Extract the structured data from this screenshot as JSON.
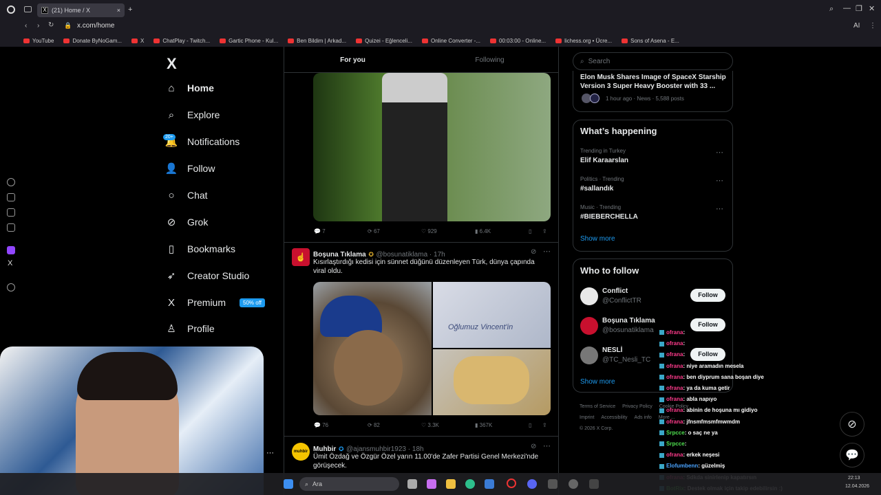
{
  "browser": {
    "tab_title": "(21) Home / X",
    "tab_favicon": "X",
    "url": "x.com/home",
    "bookmarks": [
      "YouTube",
      "Donate ByNoGam...",
      "X",
      "ChatPlay - Twitch...",
      "Gartic Phone - Kul...",
      "Ben Bildim | Arkad...",
      "Quizei - Eğlenceli...",
      "Online Converter -...",
      "00:03:00 - Online...",
      "lichess.org • Ücre...",
      "Sons of Asena - E..."
    ],
    "ai_label": "AI"
  },
  "nav": {
    "logo": "X",
    "items": [
      {
        "label": "Home",
        "icon": "home-icon",
        "glyph": "⌂"
      },
      {
        "label": "Explore",
        "icon": "search-icon",
        "glyph": "⌕"
      },
      {
        "label": "Notifications",
        "icon": "bell-icon",
        "glyph": "🔔"
      },
      {
        "label": "Follow",
        "icon": "add-person-icon",
        "glyph": "👤"
      },
      {
        "label": "Chat",
        "icon": "chat-icon",
        "glyph": "○"
      },
      {
        "label": "Grok",
        "icon": "grok-icon",
        "glyph": "⊘"
      },
      {
        "label": "Bookmarks",
        "icon": "bookmark-icon",
        "glyph": "▯"
      },
      {
        "label": "Creator Studio",
        "icon": "rocket-icon",
        "glyph": "➶"
      },
      {
        "label": "Premium",
        "icon": "x-logo-icon",
        "glyph": "X"
      },
      {
        "label": "Profile",
        "icon": "profile-icon",
        "glyph": "♙"
      }
    ],
    "notifications_badge": "20+",
    "premium_badge": "50% off"
  },
  "feed": {
    "tabs": [
      "For you",
      "Following"
    ],
    "post1_stats": {
      "replies": "7",
      "reposts": "67",
      "likes": "929",
      "views": "6.4K"
    },
    "post2": {
      "name": "Boşuna Tıklama",
      "handle": "@bosunatiklama · 17h",
      "text": "Kısırlaştırdığı kedisi için sünnet düğünü düzenleyen Türk, dünya çapında viral oldu.",
      "stats": {
        "replies": "76",
        "reposts": "82",
        "likes": "3.3K",
        "views": "367K"
      },
      "image_text": "Oğlumuz Vincent'in"
    },
    "post3": {
      "name": "Muhbir",
      "handle": "@ajansmuhbir1923 · 18h",
      "text": "Ümit Özdağ ve Özgür Özel yarın 11.00'de Zafer Partisi Genel Merkezi'nde görüşecek.",
      "avatar": "muhbir"
    }
  },
  "right": {
    "search_placeholder": "Search",
    "news_title": "Elon Musk Shares Image of SpaceX Starship Version 3 Super Heavy Booster with 33 ...",
    "news_meta": "1 hour ago · News · 5,588 posts",
    "whats_happening": "What’s happening",
    "trends": [
      {
        "context": "Trending in Turkey",
        "name": "Elif Karaarslan"
      },
      {
        "context": "Politics · Trending",
        "name": "#sallandık"
      },
      {
        "context": "Music · Trending",
        "name": "#BIEBERCHELLA"
      }
    ],
    "show_more": "Show more",
    "who_to_follow": "Who to follow",
    "follow_suggestions": [
      {
        "name": "Conflict",
        "handle": "@ConflictTR"
      },
      {
        "name": "Boşuna Tıklama",
        "handle": "@bosunatiklama"
      },
      {
        "name": "NESLİ",
        "handle": "@TC_Nesli_TC"
      }
    ],
    "follow_label": "Follow",
    "footer": [
      "Terms of Service",
      "Privacy Policy",
      "Cookie Policy",
      "Imprint",
      "Accessibility",
      "Ads info",
      "More ...",
      "© 2026 X Corp."
    ]
  },
  "chat": [
    {
      "user": "ofrana",
      "msg": ":",
      "color": "u"
    },
    {
      "user": "ofrana",
      "msg": ":",
      "color": "u"
    },
    {
      "user": "ofrana",
      "msg": ":",
      "color": "u"
    },
    {
      "user": "ofrana",
      "msg": ": niye aramadın mesela",
      "color": "u"
    },
    {
      "user": "ofrana",
      "msg": ": ben diyprum sana boşan diye",
      "color": "u"
    },
    {
      "user": "ofrana",
      "msg": ": ya da kuma getir",
      "color": "u"
    },
    {
      "user": "ofrana",
      "msg": ": abla napıyo",
      "color": "u"
    },
    {
      "user": "ofrana",
      "msg": ": abinin de hoşuna mı gidiyo",
      "color": "u"
    },
    {
      "user": "ofrana",
      "msg": ": jfnsmfmsmfmwmdm",
      "color": "u"
    },
    {
      "user": "Srpcce",
      "msg": ": o saç ne ya",
      "color": "g"
    },
    {
      "user": "Srpcce",
      "msg": ":",
      "color": "g"
    },
    {
      "user": "ofrana",
      "msg": ": erkek neşesi",
      "color": "u"
    },
    {
      "user": "Elofumbenn",
      "msg": ": güzelmiş",
      "color": "b"
    },
    {
      "user": "ofrana",
      "msg": ": Sdkda sinirlenip kapatırsın",
      "color": "u"
    },
    {
      "user": "BotRix",
      "msg": ": Destek olmak için takip edebilirsin :)",
      "color": "g"
    }
  ],
  "taskbar": {
    "search_label": "Ara",
    "time": "22:13",
    "date": "12.04.2026"
  },
  "colors": {
    "accent": "#1d9bf0",
    "background": "#000000",
    "border": "#2f3336"
  }
}
